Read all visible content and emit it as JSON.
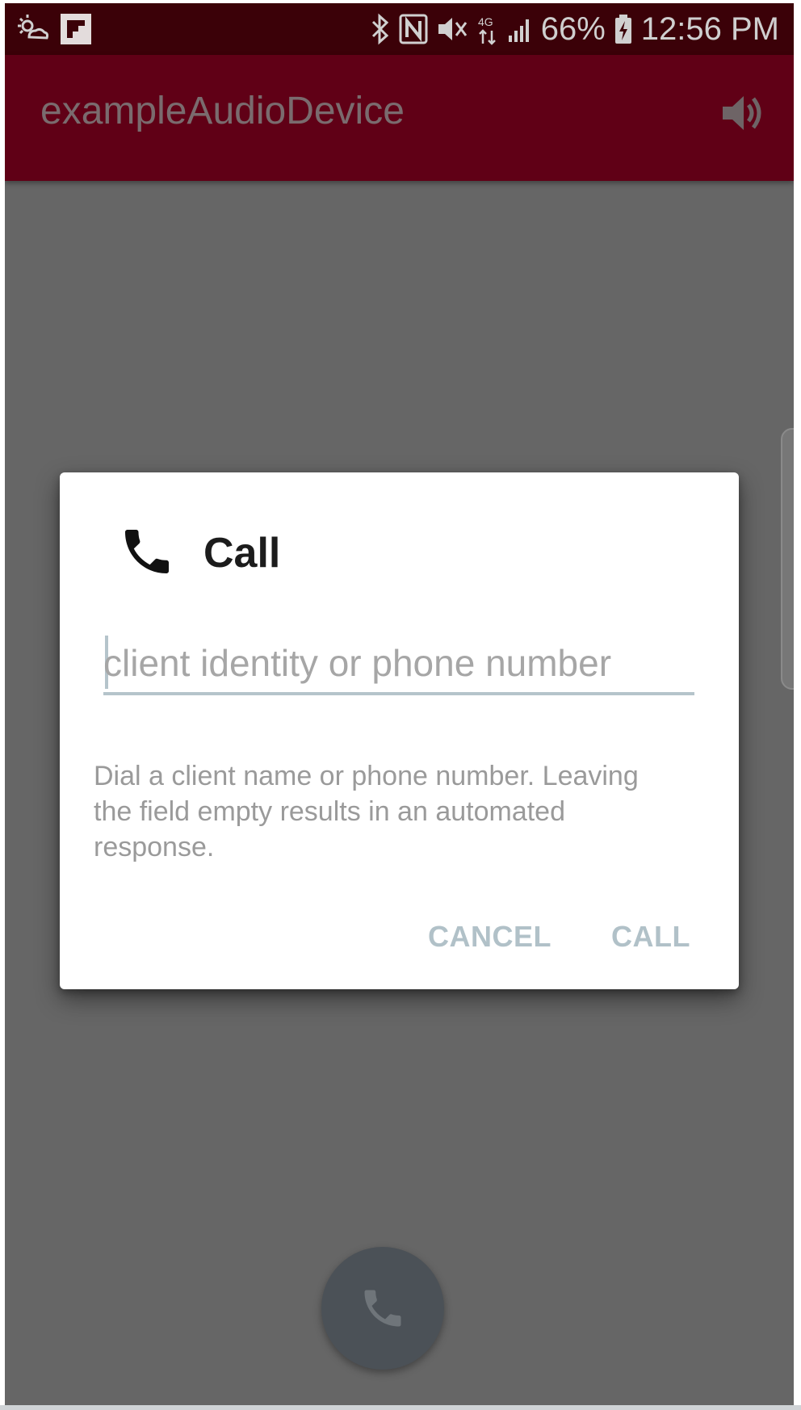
{
  "status_bar": {
    "battery_percent": "66%",
    "time": "12:56 PM",
    "network_label": "4G",
    "left_icons": [
      "weather-cloud-sun-icon",
      "flipboard-icon"
    ],
    "right_icons": [
      "bluetooth-icon",
      "nfc-icon",
      "vibrate-mute-icon",
      "data-transfer-icon",
      "signal-icon",
      "battery-charging-icon"
    ]
  },
  "app_bar": {
    "title": "exampleAudioDevice",
    "action_icon": "volume-up-icon"
  },
  "dialog": {
    "icon": "phone-icon",
    "title": "Call",
    "input": {
      "value": "",
      "placeholder": "client identity or phone number"
    },
    "message": "Dial a client name or phone number. Leaving the field empty results in an automated response.",
    "buttons": {
      "cancel": "CANCEL",
      "call": "CALL"
    }
  },
  "fab": {
    "icon": "phone-icon"
  },
  "colors": {
    "status_bar": "#3b0108",
    "app_bar": "#600016",
    "scrim": "#666666",
    "dialog_button": "#b1c1c8",
    "fab": "#4b5157"
  }
}
